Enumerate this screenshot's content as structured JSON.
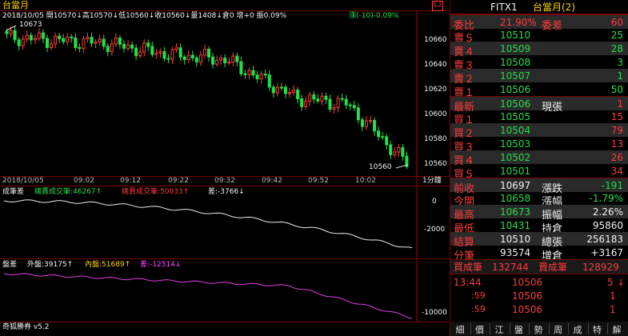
{
  "main_chart": {
    "title": "台當月",
    "info_line": "2018/10/05 開10570↓高10570↓低10560↓收10560↓量1408↓倉0 增+0 振0.09%",
    "change": "漲(-10)-0.09%",
    "hi_label": "10673",
    "lo_label": "10560",
    "y_ticks": [
      "10660",
      "10640",
      "10620",
      "10600",
      "10580",
      "10560"
    ],
    "x_ticks": [
      "2018/10/05",
      "09:02",
      "09:12",
      "09:22",
      "09:32",
      "09:42",
      "09:52",
      "10:02"
    ],
    "interval_label": "1分鐘",
    "corner_mark": "囗"
  },
  "volume_panel": {
    "label": "成筆差",
    "total_sell": "總賣成交筆:46267↑",
    "total_buy": "總買成交筆:50033↑",
    "diff": "差:-3766↓",
    "y_ticks": [
      "0",
      "-2000"
    ]
  },
  "inout_panel": {
    "label": "盤差",
    "out": "外盤:39175↑",
    "in": "內盤:51689↑",
    "diff": "差:-12514↓",
    "y_ticks": [
      "-10000"
    ],
    "software": "奇狐勝券 v5.2"
  },
  "quote_panel": {
    "header_code": "FITX1",
    "header_name": "台當月(2)",
    "rows": [
      {
        "l": "委比",
        "v": "21.90%",
        "l2": "委差",
        "v2": "60",
        "lc": "red",
        "vc": "red",
        "l2c": "red",
        "v2c": "red"
      },
      {
        "l": "賣５",
        "v": "10510",
        "l2": "",
        "v2": "25",
        "lc": "red",
        "vc": "green",
        "v2c": "green"
      },
      {
        "l": "賣４",
        "v": "10509",
        "l2": "",
        "v2": "28",
        "lc": "red",
        "vc": "green",
        "v2c": "green"
      },
      {
        "l": "賣３",
        "v": "10508",
        "l2": "",
        "v2": "3",
        "lc": "red",
        "vc": "green",
        "v2c": "green"
      },
      {
        "l": "賣２",
        "v": "10507",
        "l2": "",
        "v2": "1",
        "lc": "red",
        "vc": "green",
        "v2c": "green"
      },
      {
        "l": "賣１",
        "v": "10506",
        "l2": "",
        "v2": "50",
        "lc": "red",
        "vc": "green",
        "v2c": "green"
      },
      {
        "l": "最新",
        "v": "10506",
        "l2": "現張",
        "v2": "1",
        "lc": "yellow",
        "vc": "green",
        "l2c": "white",
        "v2c": "red"
      },
      {
        "l": "買１",
        "v": "10505",
        "l2": "",
        "v2": "15",
        "lc": "red",
        "vc": "green",
        "v2c": "red"
      },
      {
        "l": "買２",
        "v": "10504",
        "l2": "",
        "v2": "79",
        "lc": "red",
        "vc": "green",
        "v2c": "red"
      },
      {
        "l": "買３",
        "v": "10503",
        "l2": "",
        "v2": "13",
        "lc": "red",
        "vc": "green",
        "v2c": "red"
      },
      {
        "l": "買４",
        "v": "10502",
        "l2": "",
        "v2": "26",
        "lc": "red",
        "vc": "green",
        "v2c": "red"
      },
      {
        "l": "買５",
        "v": "10501",
        "l2": "",
        "v2": "34",
        "lc": "red",
        "vc": "green",
        "v2c": "red"
      },
      {
        "l": "前收",
        "v": "10697",
        "l2": "漲跌",
        "v2": "-191",
        "lc": "white",
        "vc": "white",
        "l2c": "white",
        "v2c": "green"
      },
      {
        "l": "今開",
        "v": "10658",
        "l2": "漲幅",
        "v2": "-1.79%",
        "lc": "white",
        "vc": "green",
        "l2c": "white",
        "v2c": "green"
      },
      {
        "l": "最高",
        "v": "10673",
        "l2": "振幅",
        "v2": "2.26%",
        "lc": "white",
        "vc": "green",
        "l2c": "white",
        "v2c": "white"
      },
      {
        "l": "最低",
        "v": "10431",
        "l2": "持倉",
        "v2": "95860",
        "lc": "white",
        "vc": "green",
        "l2c": "white",
        "v2c": "white"
      },
      {
        "l": "結算",
        "v": "10510",
        "l2": "總張",
        "v2": "256183",
        "lc": "white",
        "vc": "white",
        "l2c": "white",
        "v2c": "white"
      },
      {
        "l": "分筆",
        "v": "93574",
        "l2": "增倉",
        "v2": "+3167",
        "lc": "white",
        "vc": "white",
        "l2c": "white",
        "v2c": "white"
      }
    ],
    "bottom_buy_label": "買成筆",
    "bottom_buy": "132744",
    "bottom_sell_label": "賣成筆",
    "bottom_sell": "128929",
    "ticks": [
      {
        "time": "13:44",
        "price": "10506",
        "qty": "5",
        "mark": "↓"
      },
      {
        "time": ":59",
        "price": "10506",
        "qty": "1",
        "mark": ""
      },
      {
        "time": ":59",
        "price": "10506",
        "qty": "1",
        "mark": ""
      }
    ]
  },
  "tabs": [
    "細",
    "價",
    "江",
    "盤",
    "勢",
    "周",
    "成",
    "特",
    "解"
  ],
  "colors": {
    "up": "#ff3b3b",
    "down": "#22e04a",
    "frame": "#7a0000",
    "accent": "#ffd400"
  }
}
